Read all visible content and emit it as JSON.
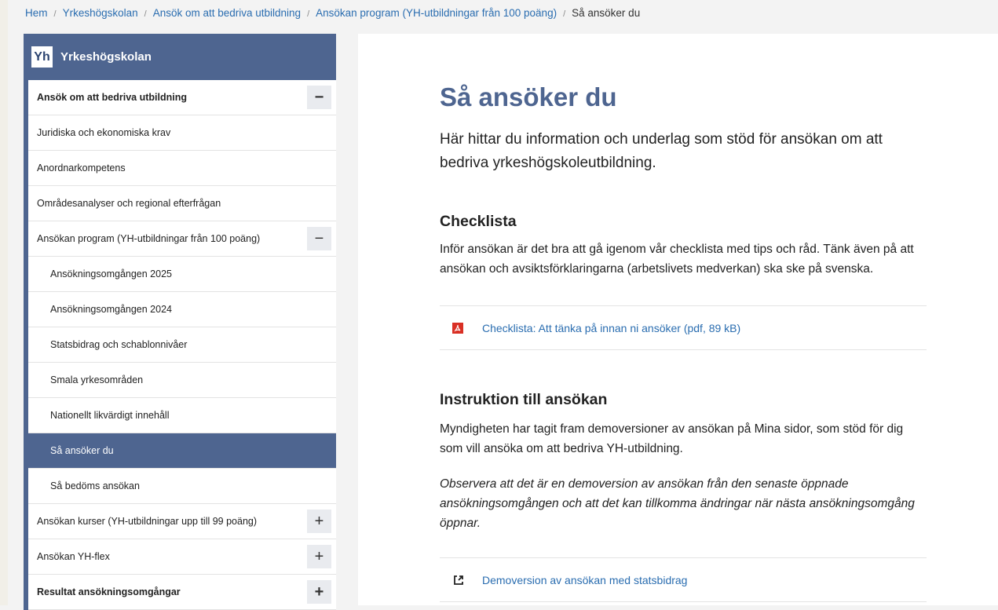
{
  "breadcrumb": {
    "items": [
      "Hem",
      "Yrkeshögskolan",
      "Ansök om att bedriva utbildning",
      "Ansökan program (YH-utbildningar från 100 poäng)"
    ],
    "current": "Så ansöker du",
    "separator": "/"
  },
  "sidebar": {
    "logo": "Yh",
    "title": "Yrkeshögskolan",
    "items": [
      {
        "label": "Ansök om att bedriva utbildning",
        "toggle": "−"
      },
      {
        "label": "Juridiska och ekonomiska krav"
      },
      {
        "label": "Anordnarkompetens"
      },
      {
        "label": "Områdesanalyser och regional efterfrågan"
      },
      {
        "label": "Ansökan program (YH-utbildningar från 100 poäng)",
        "toggle": "−"
      },
      {
        "label": "Ansökningsomgången 2025"
      },
      {
        "label": "Ansökningsomgången 2024"
      },
      {
        "label": "Statsbidrag och schablonnivåer"
      },
      {
        "label": "Smala yrkesområden"
      },
      {
        "label": "Nationellt likvärdigt innehåll"
      },
      {
        "label": "Så ansöker du"
      },
      {
        "label": "Så bedöms ansökan"
      },
      {
        "label": "Ansökan kurser (YH-utbildningar upp till 99 poäng)",
        "toggle": "+"
      },
      {
        "label": "Ansökan YH-flex",
        "toggle": "+"
      },
      {
        "label": "Resultat ansökningsomgångar",
        "toggle": "+"
      }
    ]
  },
  "main": {
    "title": "Så ansöker du",
    "lead": "Här hittar du information och underlag som stöd för ansökan om att bedriva yrkeshögskoleutbildning.",
    "checklist": {
      "heading": "Checklista",
      "text": "Inför ansökan är det bra att gå igenom vår checklista med tips och råd. Tänk även på att ansökan och avsiktsförklaringarna (arbetslivets medverkan) ska ske på svenska.",
      "link": "Checklista: Att tänka på innan ni ansöker (pdf, 89 kB)"
    },
    "instruction": {
      "heading": "Instruktion till ansökan",
      "text": "Myndigheten har tagit fram demoversioner av ansökan på Mina sidor, som stöd för dig som vill ansöka om att bedriva YH-utbildning.",
      "note": "Observera att det är en demoversion av ansökan från den senaste öppnade ansökningsomgången och att det kan tillkomma ändringar när nästa ansökningsomgång öppnar.",
      "link": "Demoversion av ansökan med statsbidrag"
    }
  },
  "colors": {
    "accent": "#4e6590",
    "link": "#2a6db0",
    "pdf": "#d93025"
  },
  "icons": {
    "pdf": "pdf-icon",
    "external": "external-link-icon"
  }
}
